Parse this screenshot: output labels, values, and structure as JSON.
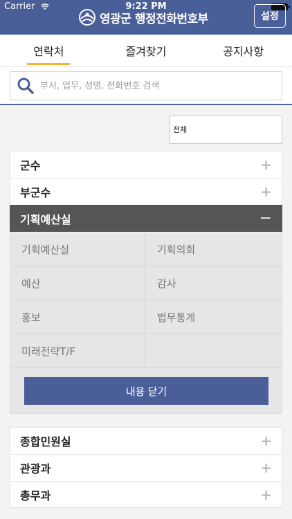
{
  "status": {
    "carrier": "Carrier",
    "time": "9:22 PM"
  },
  "header": {
    "title": "영광군 행정전화번호부",
    "settings_label": "설정"
  },
  "tabs": [
    {
      "label": "연락처",
      "active": true
    },
    {
      "label": "즐겨찾기",
      "active": false
    },
    {
      "label": "공지사항",
      "active": false
    }
  ],
  "search": {
    "placeholder": "부서, 업무, 성명, 전화번호 검색"
  },
  "filter": {
    "selected": "전체"
  },
  "departments_top": [
    {
      "label": "군수"
    },
    {
      "label": "부군수"
    }
  ],
  "expanded": {
    "label": "기획예산실",
    "items": [
      "기획예산실",
      "기획의회",
      "예산",
      "감사",
      "홍보",
      "법무통계",
      "미래전략T/F",
      ""
    ],
    "close_label": "내용 닫기"
  },
  "departments_bottom": [
    {
      "label": "종합민원실"
    },
    {
      "label": "관광과"
    },
    {
      "label": "총무과"
    }
  ],
  "colors": {
    "header": "#4a5f98",
    "tab_indicator": "#f0b62e",
    "expanded_row": "#555555"
  }
}
